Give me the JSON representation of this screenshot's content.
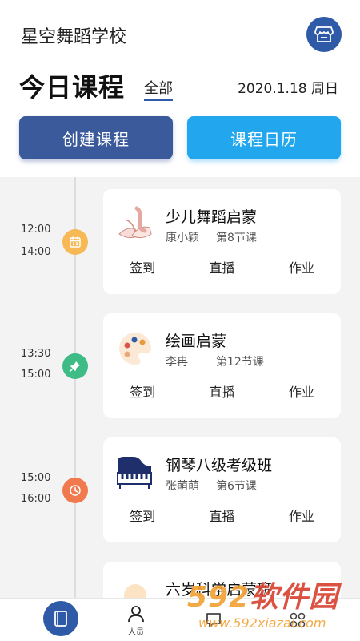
{
  "header": {
    "school_name": "星空舞蹈学校",
    "title": "今日课程",
    "filter_label": "全部",
    "date": "2020.1.18 周日"
  },
  "buttons": {
    "create": "创建课程",
    "calendar": "课程日历"
  },
  "courses": [
    {
      "start": "12:00",
      "end": "14:00",
      "icon": "calendar-icon",
      "icon_color": "#f6b955",
      "name": "少儿舞蹈启蒙",
      "teacher": "康小颖",
      "lesson": "第8节课",
      "actions": [
        "签到",
        "直播",
        "作业"
      ]
    },
    {
      "start": "13:30",
      "end": "15:00",
      "icon": "pin-icon",
      "icon_color": "#3fbb86",
      "name": "绘画启蒙",
      "teacher": "李冉",
      "lesson": "第12节课",
      "actions": [
        "签到",
        "直播",
        "作业"
      ]
    },
    {
      "start": "15:00",
      "end": "16:00",
      "icon": "clock-icon",
      "icon_color": "#f07a4d",
      "name": "钢琴八级考级班",
      "teacher": "张萌萌",
      "lesson": "第6节课",
      "actions": [
        "签到",
        "直播",
        "作业"
      ]
    },
    {
      "name": "六岁科学启蒙班"
    }
  ],
  "tabbar": {
    "people_label": "人员"
  },
  "watermark": {
    "main_left": "592",
    "main_right": "软件园",
    "url": "www.592xiazai.com"
  },
  "colors": {
    "primary": "#2f5aa8",
    "create_button": "#3b5a9c",
    "calendar_button": "#22a7ef"
  }
}
